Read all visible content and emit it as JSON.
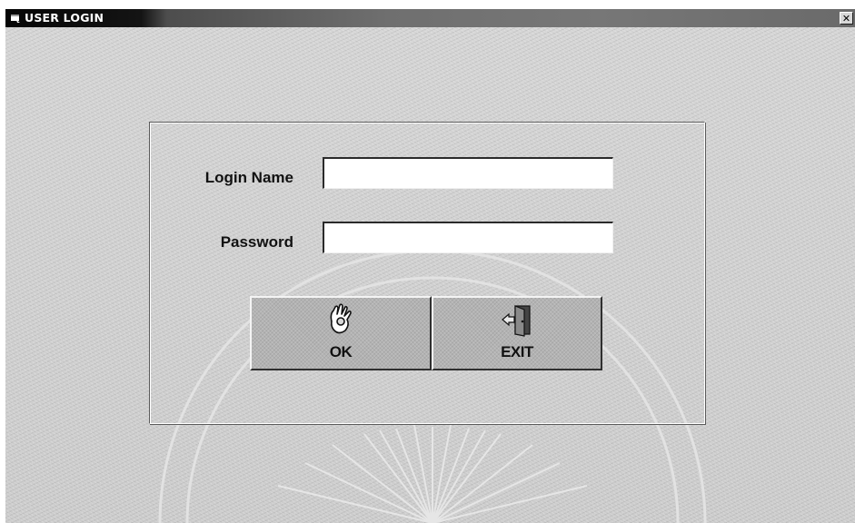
{
  "window": {
    "title": "USER LOGIN",
    "icon": "app-window-icon",
    "close_label": "✕"
  },
  "form": {
    "login_name_label": "Login Name",
    "login_name_value": "",
    "password_label": "Password",
    "password_value": ""
  },
  "buttons": {
    "ok": {
      "label": "OK",
      "icon": "ok-hand-icon"
    },
    "exit": {
      "label": "EXIT",
      "icon": "exit-door-icon"
    }
  },
  "colors": {
    "titlebar_dark": "#050505",
    "window_bg": "#cfcfcf",
    "button_face": "#b3b3b3"
  }
}
